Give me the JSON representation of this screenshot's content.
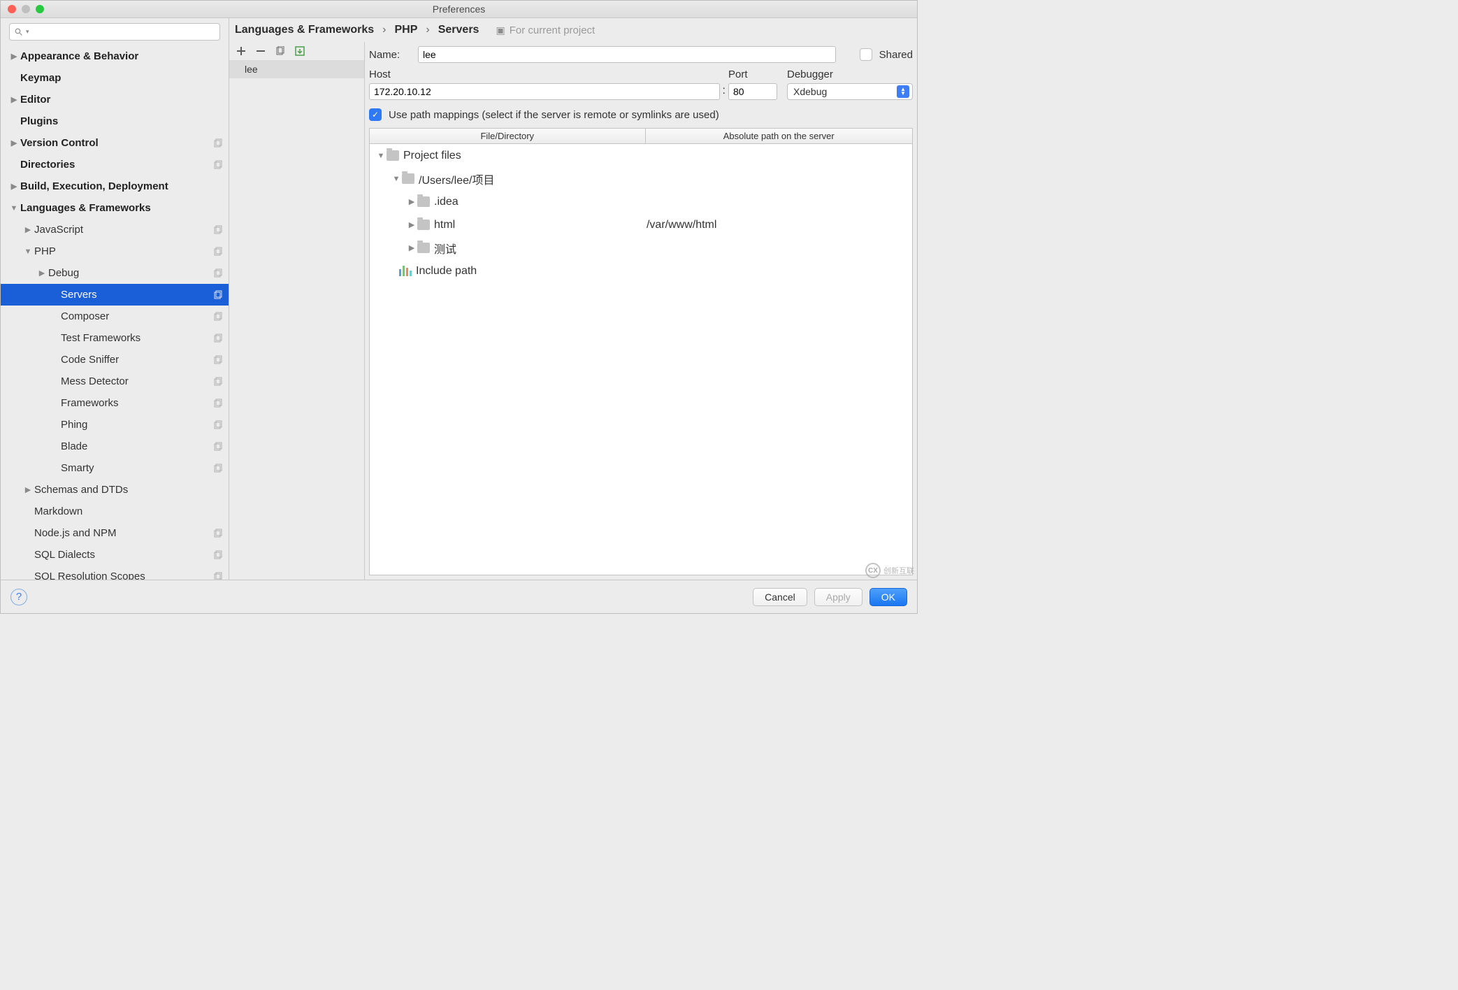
{
  "window": {
    "title": "Preferences"
  },
  "search": {
    "placeholder": ""
  },
  "sidebar": {
    "items": [
      {
        "label": "Appearance & Behavior",
        "bold": true,
        "arrow": "▶",
        "indent": 0,
        "copy": false
      },
      {
        "label": "Keymap",
        "bold": true,
        "arrow": "",
        "indent": 0,
        "copy": false
      },
      {
        "label": "Editor",
        "bold": true,
        "arrow": "▶",
        "indent": 0,
        "copy": false
      },
      {
        "label": "Plugins",
        "bold": true,
        "arrow": "",
        "indent": 0,
        "copy": false
      },
      {
        "label": "Version Control",
        "bold": true,
        "arrow": "▶",
        "indent": 0,
        "copy": true
      },
      {
        "label": "Directories",
        "bold": true,
        "arrow": "",
        "indent": 0,
        "copy": true
      },
      {
        "label": "Build, Execution, Deployment",
        "bold": true,
        "arrow": "▶",
        "indent": 0,
        "copy": false
      },
      {
        "label": "Languages & Frameworks",
        "bold": true,
        "arrow": "▼",
        "indent": 0,
        "copy": false
      },
      {
        "label": "JavaScript",
        "bold": false,
        "arrow": "▶",
        "indent": 1,
        "copy": true
      },
      {
        "label": "PHP",
        "bold": false,
        "arrow": "▼",
        "indent": 1,
        "copy": true
      },
      {
        "label": "Debug",
        "bold": false,
        "arrow": "▶",
        "indent": 2,
        "copy": true
      },
      {
        "label": "Servers",
        "bold": false,
        "arrow": "",
        "indent": 3,
        "copy": true,
        "selected": true
      },
      {
        "label": "Composer",
        "bold": false,
        "arrow": "",
        "indent": 3,
        "copy": true
      },
      {
        "label": "Test Frameworks",
        "bold": false,
        "arrow": "",
        "indent": 3,
        "copy": true
      },
      {
        "label": "Code Sniffer",
        "bold": false,
        "arrow": "",
        "indent": 3,
        "copy": true
      },
      {
        "label": "Mess Detector",
        "bold": false,
        "arrow": "",
        "indent": 3,
        "copy": true
      },
      {
        "label": "Frameworks",
        "bold": false,
        "arrow": "",
        "indent": 3,
        "copy": true
      },
      {
        "label": "Phing",
        "bold": false,
        "arrow": "",
        "indent": 3,
        "copy": true
      },
      {
        "label": "Blade",
        "bold": false,
        "arrow": "",
        "indent": 3,
        "copy": true
      },
      {
        "label": "Smarty",
        "bold": false,
        "arrow": "",
        "indent": 3,
        "copy": true
      },
      {
        "label": "Schemas and DTDs",
        "bold": false,
        "arrow": "▶",
        "indent": 1,
        "copy": false
      },
      {
        "label": "Markdown",
        "bold": false,
        "arrow": "",
        "indent": 1,
        "copy": false
      },
      {
        "label": "Node.js and NPM",
        "bold": false,
        "arrow": "",
        "indent": 1,
        "copy": true
      },
      {
        "label": "SQL Dialects",
        "bold": false,
        "arrow": "",
        "indent": 1,
        "copy": true
      },
      {
        "label": "SQL Resolution Scopes",
        "bold": false,
        "arrow": "",
        "indent": 1,
        "copy": true
      }
    ]
  },
  "breadcrumb": {
    "a": "Languages & Frameworks",
    "b": "PHP",
    "c": "Servers",
    "scope": "For current project"
  },
  "servers": {
    "items": [
      {
        "name": "lee"
      }
    ]
  },
  "form": {
    "name_label": "Name:",
    "name_value": "lee",
    "shared_label": "Shared",
    "host_label": "Host",
    "host_value": "172.20.10.12",
    "port_label": "Port",
    "port_value": "80",
    "debugger_label": "Debugger",
    "debugger_value": "Xdebug",
    "mappings_label": "Use path mappings (select if the server is remote or symlinks are used)"
  },
  "table": {
    "h1": "File/Directory",
    "h2": "Absolute path on the server",
    "rows": [
      {
        "arrow": "▼",
        "icon": "folder",
        "label": "Project files",
        "pad": 8,
        "path": ""
      },
      {
        "arrow": "▼",
        "icon": "folder",
        "label": "/Users/lee/项目",
        "pad": 30,
        "path": ""
      },
      {
        "arrow": "▶",
        "icon": "folder",
        "label": ".idea",
        "pad": 52,
        "path": ""
      },
      {
        "arrow": "▶",
        "icon": "folder",
        "label": "html",
        "pad": 52,
        "path": "/var/www/html"
      },
      {
        "arrow": "▶",
        "icon": "folder",
        "label": "测试",
        "pad": 52,
        "path": ""
      },
      {
        "arrow": "",
        "icon": "include",
        "label": "Include path",
        "pad": 26,
        "path": ""
      }
    ]
  },
  "footer": {
    "cancel": "Cancel",
    "apply": "Apply",
    "ok": "OK"
  },
  "watermark": "创新互联"
}
